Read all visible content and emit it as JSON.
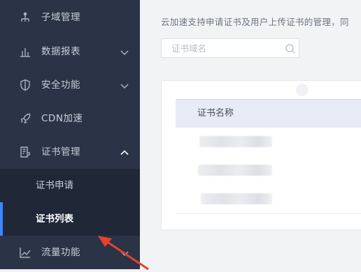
{
  "sidebar": {
    "items": [
      {
        "label": "子域管理",
        "icon": "subdomain-tree-icon",
        "chevron": ""
      },
      {
        "label": "数据报表",
        "icon": "bar-chart-icon",
        "chevron": "down"
      },
      {
        "label": "安全功能",
        "icon": "shield-icon",
        "chevron": "down"
      },
      {
        "label": "CDN加速",
        "icon": "rocket-icon",
        "chevron": ""
      },
      {
        "label": "证书管理",
        "icon": "certificate-icon",
        "chevron": "up"
      },
      {
        "label": "流量功能",
        "icon": "traffic-chart-icon",
        "chevron": "down"
      }
    ],
    "submenu": [
      {
        "label": "证书申请",
        "active": false
      },
      {
        "label": "证书列表",
        "active": true
      }
    ],
    "active_color": "#3b86ff"
  },
  "main": {
    "description": "云加速支持申请证书及用户上传证书的管理，同",
    "search": {
      "placeholder": "证书域名",
      "value": ""
    },
    "table": {
      "columns": [
        "证书名称"
      ],
      "rows": [
        "(redacted)",
        "(redacted)",
        "(redacted)"
      ]
    }
  },
  "annotation": {
    "color": "#e8402f",
    "icon": "red-arrow-icon"
  }
}
